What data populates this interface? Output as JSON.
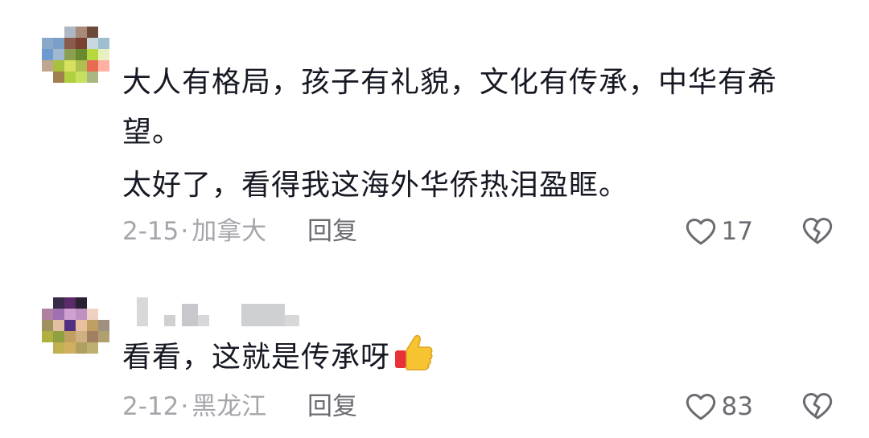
{
  "comments": [
    {
      "lines": [
        "大人有格局，孩子有礼貌，文化有传承，中华有希",
        "望。",
        "太好了，看得我这海外华侨热泪盈眶。"
      ],
      "date": "2-15",
      "location": "加拿大",
      "reply_label": "回复",
      "likes": "17",
      "avatar_colors": [
        "#ffffff",
        "#ffffff",
        "#b0b7c4",
        "#a88a7a",
        "#6b4a3a",
        "#ffffff",
        "#8aa9c8",
        "#7aa0c8",
        "#8a5a4a",
        "#7a4030",
        "#c8d8e0",
        "#9fbfd0",
        "#6f9ad0",
        "#a0b8d0",
        "#8aa050",
        "#6a8a30",
        "#b8d840",
        "#e8f0c0",
        "#c0a890",
        "#a8c040",
        "#d8e060",
        "#b0c050",
        "#e86a50",
        "#ffb0a0",
        "#ffffff",
        "#a08050",
        "#b0d040",
        "#c8e060",
        "#a8b880",
        "#ffffff",
        "#ffffff",
        "#ffffff",
        "#ffffff",
        "#ffffff",
        "#ffffff",
        "#ffffff"
      ]
    },
    {
      "text": "看看，这就是传承呀",
      "emoji": "thumbs-up-icon",
      "date": "2-12",
      "location": "黑龙江",
      "reply_label": "回复",
      "likes": "83",
      "avatar_colors": [
        "#ffffff",
        "#3a2a4a",
        "#5a2a6a",
        "#2a2030",
        "#ffffff",
        "#ffffff",
        "#b080a0",
        "#a070b0",
        "#d0a0d0",
        "#c090c0",
        "#f0d0c0",
        "#ffffff",
        "#a09060",
        "#e0c0a0",
        "#503080",
        "#e8c0a0",
        "#c0a060",
        "#a09080",
        "#b0b040",
        "#90a040",
        "#c0a060",
        "#d0b080",
        "#a08060",
        "#b0a070",
        "#ffffff",
        "#c0b050",
        "#d0b060",
        "#b0a060",
        "#c0b070",
        "#ffffff",
        "#ffffff",
        "#ffffff",
        "#ffffff",
        "#ffffff",
        "#ffffff",
        "#ffffff"
      ]
    }
  ]
}
